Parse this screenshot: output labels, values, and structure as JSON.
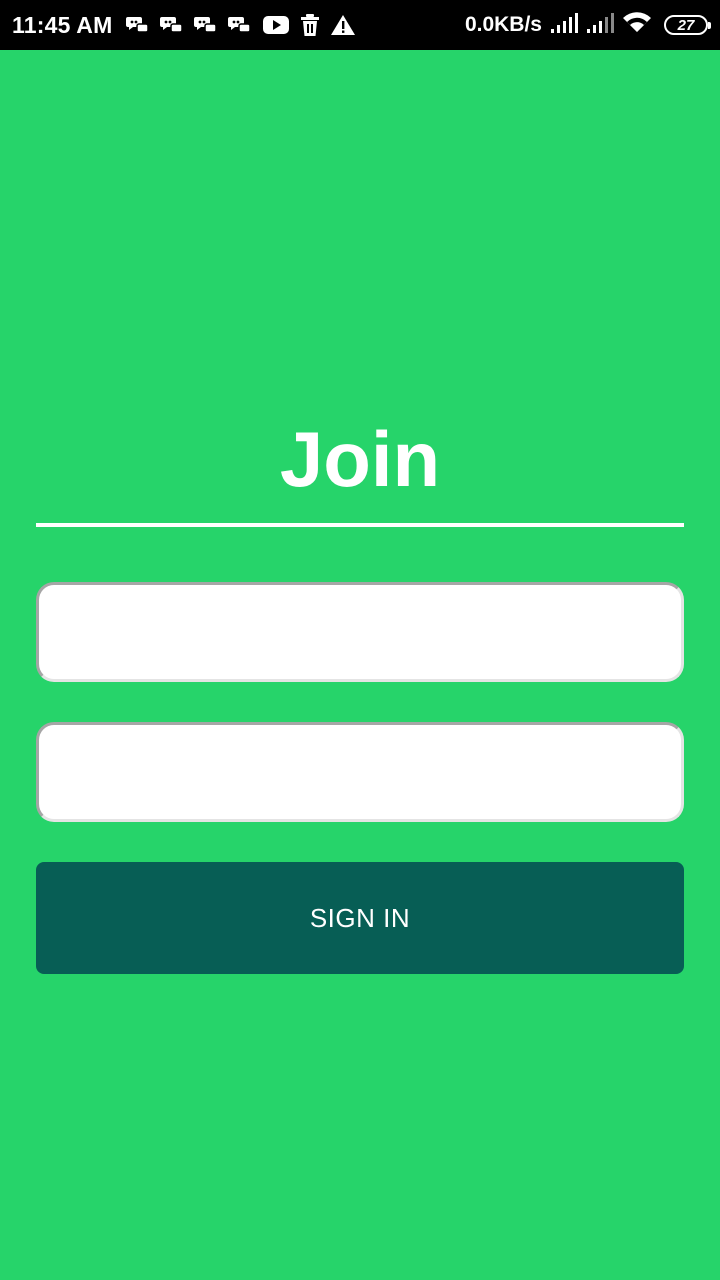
{
  "status_bar": {
    "time": "11:45 AM",
    "notification_icons": [
      "chat-bubbles-icon",
      "chat-bubbles-icon",
      "chat-bubbles-icon",
      "chat-bubbles-icon",
      "youtube-icon",
      "trash-icon",
      "warning-icon"
    ],
    "network_speed": "0.0KB/s",
    "battery_level": "27"
  },
  "login": {
    "title": "Join",
    "username_value": "",
    "password_value": "",
    "sign_in_label": "SIGN IN"
  },
  "colors": {
    "background": "#26d46a",
    "button": "#075e55",
    "status_bar": "#000000",
    "text_light": "#ffffff"
  }
}
